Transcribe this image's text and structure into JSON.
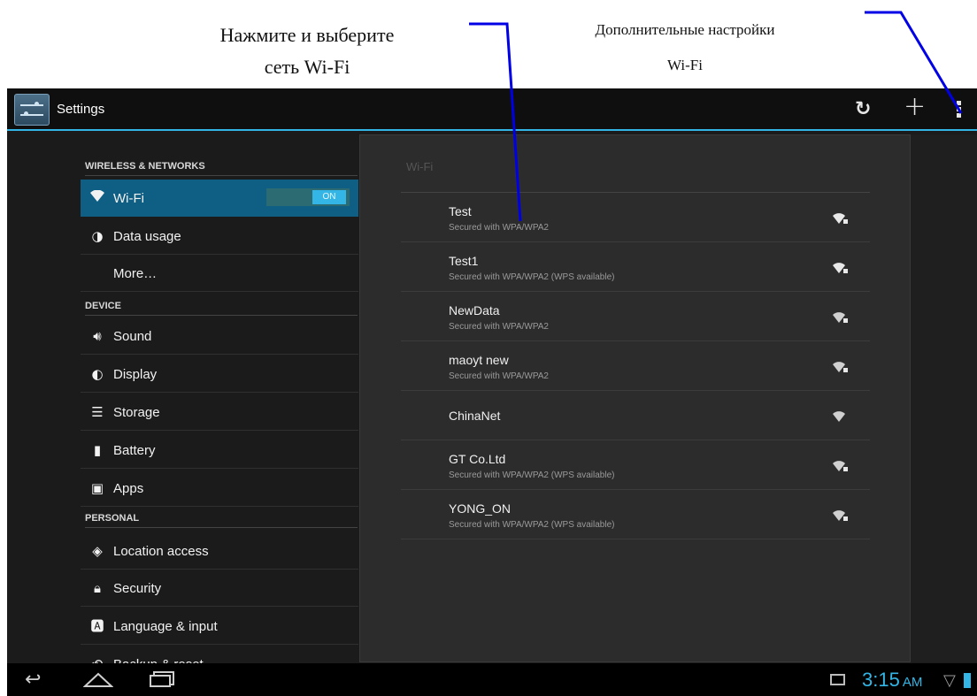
{
  "annotations": {
    "select_network_line1": "Нажмите и выберите",
    "select_network_line2": "сеть Wi-Fi",
    "advanced_line1": "Дополнительные настройки",
    "advanced_line2": "Wi-Fi"
  },
  "action_bar": {
    "title": "Settings",
    "icons": [
      "settings-app-icon",
      "wps-sync-icon",
      "add-network-icon",
      "overflow-menu-icon"
    ]
  },
  "sidebar": {
    "wireless_header": "WIRELESS & NETWORKS",
    "device_header": "DEVICE",
    "personal_header": "PERSONAL",
    "items": [
      {
        "label": "Wi-Fi",
        "icon": "wifi-icon"
      },
      {
        "label": "Data usage",
        "icon": "data-usage-icon"
      },
      {
        "label": "More…",
        "icon": ""
      },
      {
        "label": "Sound",
        "icon": "sound-icon"
      },
      {
        "label": "Display",
        "icon": "display-icon"
      },
      {
        "label": "Storage",
        "icon": "storage-icon"
      },
      {
        "label": "Battery",
        "icon": "battery-icon"
      },
      {
        "label": "Apps",
        "icon": "apps-icon"
      },
      {
        "label": "Location access",
        "icon": "location-icon"
      },
      {
        "label": "Security",
        "icon": "lock-icon"
      },
      {
        "label": "Language & input",
        "icon": "language-icon"
      },
      {
        "label": "Backup & reset",
        "icon": "backup-icon"
      }
    ],
    "wifi_toggle": "ON"
  },
  "wifi_panel": {
    "title": "Wi-Fi",
    "networks": [
      {
        "ssid": "Test",
        "security": "Secured with WPA/WPA2"
      },
      {
        "ssid": "Test1",
        "security": "Secured with WPA/WPA2 (WPS available)"
      },
      {
        "ssid": "NewData",
        "security": "Secured with WPA/WPA2"
      },
      {
        "ssid": "maoyt new",
        "security": "Secured with WPA/WPA2"
      },
      {
        "ssid": "ChinaNet",
        "security": ""
      },
      {
        "ssid": "GT Co.Ltd",
        "security": "Secured with WPA/WPA2 (WPS available)"
      },
      {
        "ssid": "YONG_ON",
        "security": "Secured with WPA/WPA2 (WPS available)"
      }
    ]
  },
  "status_bar": {
    "time": "3:15",
    "ampm": "AM",
    "accent": "#33b5e5"
  }
}
